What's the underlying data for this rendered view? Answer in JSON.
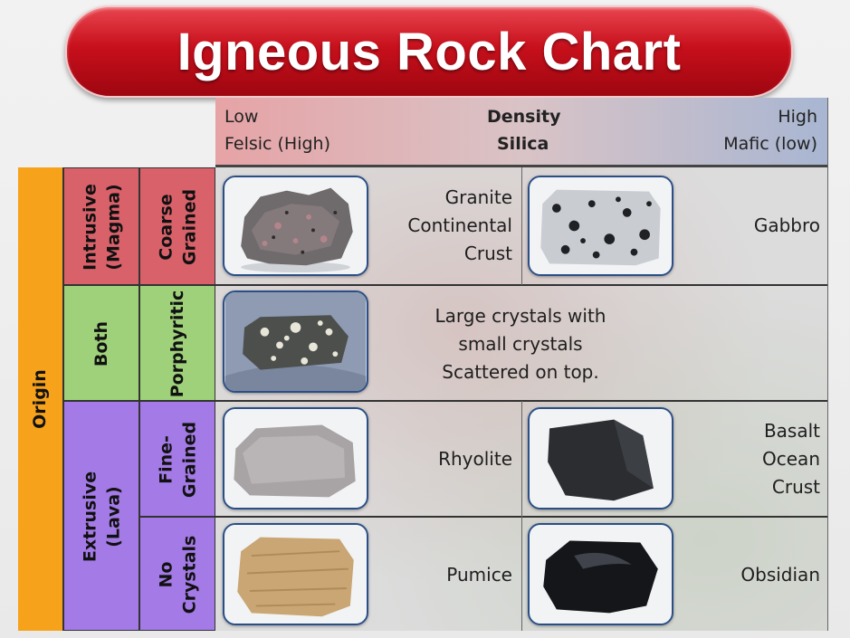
{
  "title": "Igneous Rock Chart",
  "header": {
    "low": "Low",
    "density": "Density",
    "high": "High",
    "felsic": "Felsic (High)",
    "silica": "Silica",
    "mafic": "Mafic (low)"
  },
  "origin_label": "Origin",
  "groups": {
    "intrusive": [
      "Intrusive",
      "(Magma)"
    ],
    "both": "Both",
    "extrusive": [
      "Extrusive",
      "(Lava)"
    ]
  },
  "textures": {
    "coarse": [
      "Coarse",
      "Grained"
    ],
    "porphyritic": "Porphyritic",
    "fine": [
      "Fine-",
      "Grained"
    ],
    "no_crystals": [
      "No",
      "Crystals"
    ]
  },
  "rows": {
    "coarse": {
      "felsic": [
        "Granite",
        "Continental",
        "Crust"
      ],
      "mafic": "Gabbro"
    },
    "porphyritic": {
      "description": [
        "Large crystals with",
        "small crystals",
        "Scattered on top."
      ]
    },
    "fine": {
      "felsic": "Rhyolite",
      "mafic": [
        "Basalt",
        "Ocean",
        "Crust"
      ]
    },
    "no_crystals": {
      "felsic": "Pumice",
      "mafic": "Obsidian"
    }
  },
  "colors": {
    "title_red": "#c7101c",
    "origin_orange": "#f7a21b",
    "intrusive_red": "#d9616a",
    "both_green": "#9ed17a",
    "extrusive_purple": "#a37ae6"
  }
}
